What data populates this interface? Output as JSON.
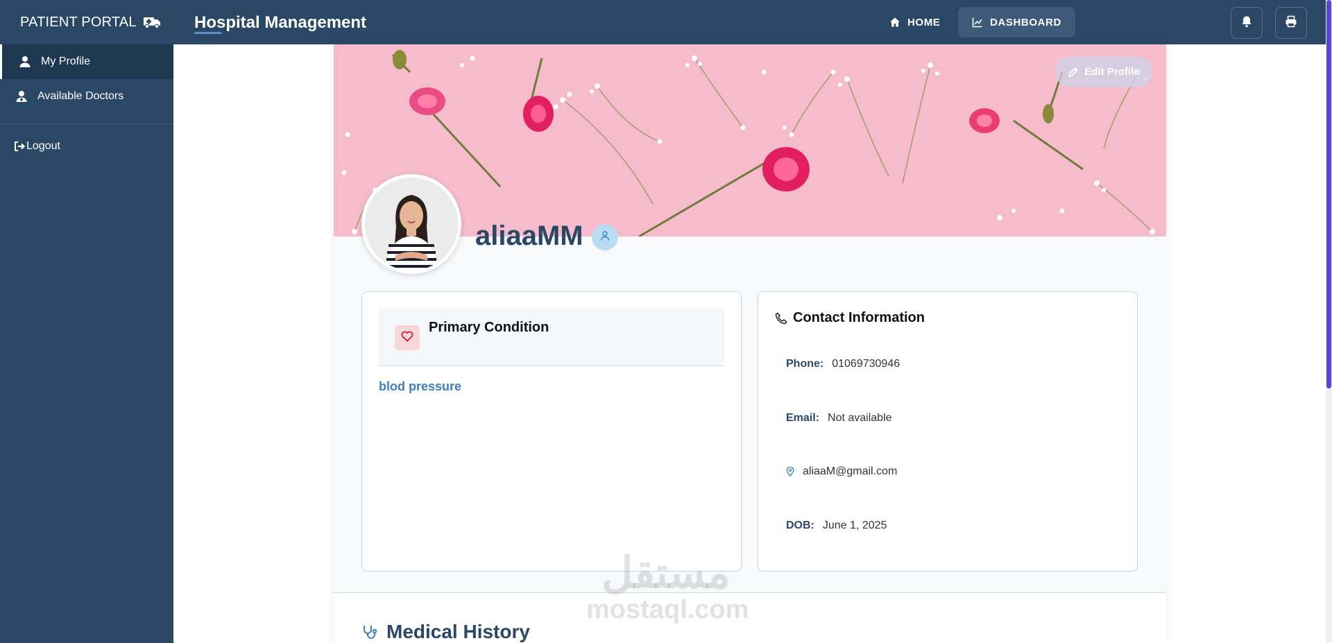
{
  "sidebar": {
    "brand": "PATIENT PORTAL",
    "items": [
      {
        "label": "My Profile",
        "icon": "user-icon",
        "active": true
      },
      {
        "label": "Available Doctors",
        "icon": "doctor-icon",
        "active": false
      }
    ],
    "logout": "Logout"
  },
  "header": {
    "title": "Hospital Management",
    "nav": [
      {
        "label": "HOME",
        "icon": "home-icon"
      },
      {
        "label": "DASHBOARD",
        "icon": "chart-line-icon",
        "active": true
      }
    ],
    "actions": [
      {
        "name": "notifications",
        "icon": "bell-icon"
      },
      {
        "name": "print",
        "icon": "printer-icon"
      }
    ]
  },
  "profile": {
    "edit_label": "Edit Profile",
    "username": "aliaaMM"
  },
  "primary_condition": {
    "title": "Primary Condition",
    "value": "blod pressure"
  },
  "contact": {
    "title": "Contact Information",
    "phone_label": "Phone:",
    "phone": "01069730946",
    "email_label": "Email:",
    "email": "Not available",
    "address": "aliaaM@gmail.com",
    "dob_label": "DOB:",
    "dob": "June 1, 2025"
  },
  "medical_history": {
    "title": "Medical History"
  },
  "watermark": {
    "arabic": "مستقل",
    "latin": "mostaql.com"
  },
  "colors": {
    "sidebar": "#2a4865",
    "accent": "#3c7fbf",
    "banner": "#f5b9c9",
    "scrollbar": "#5846d4"
  }
}
